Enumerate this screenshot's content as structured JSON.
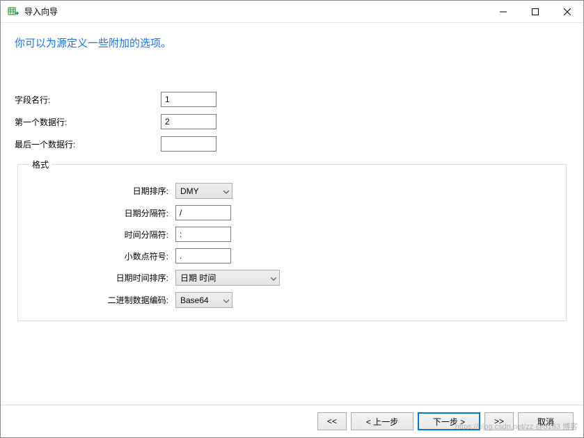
{
  "window": {
    "title": "导入向导"
  },
  "headline": "你可以为源定义一些附加的选项。",
  "fields": {
    "field_name_row_label": "字段名行:",
    "field_name_row_value": "1",
    "first_data_row_label": "第一个数据行:",
    "first_data_row_value": "2",
    "last_data_row_label": "最后一个数据行:",
    "last_data_row_value": ""
  },
  "format": {
    "legend": "格式",
    "date_order_label": "日期排序:",
    "date_order_value": "DMY",
    "date_sep_label": "日期分隔符:",
    "date_sep_value": "/",
    "time_sep_label": "时间分隔符:",
    "time_sep_value": ":",
    "decimal_sym_label": "小数点符号:",
    "decimal_sym_value": ".",
    "datetime_order_label": "日期时间排序:",
    "datetime_order_value": "日期 时间",
    "binary_enc_label": "二进制数据编码:",
    "binary_enc_value": "Base64"
  },
  "footer": {
    "first": "<<",
    "prev": "< 上一步",
    "next": "下一步 >",
    "last": ">>",
    "cancel": "取消"
  },
  "watermark": "https://blog.csdn.net/zz @5163 博客"
}
